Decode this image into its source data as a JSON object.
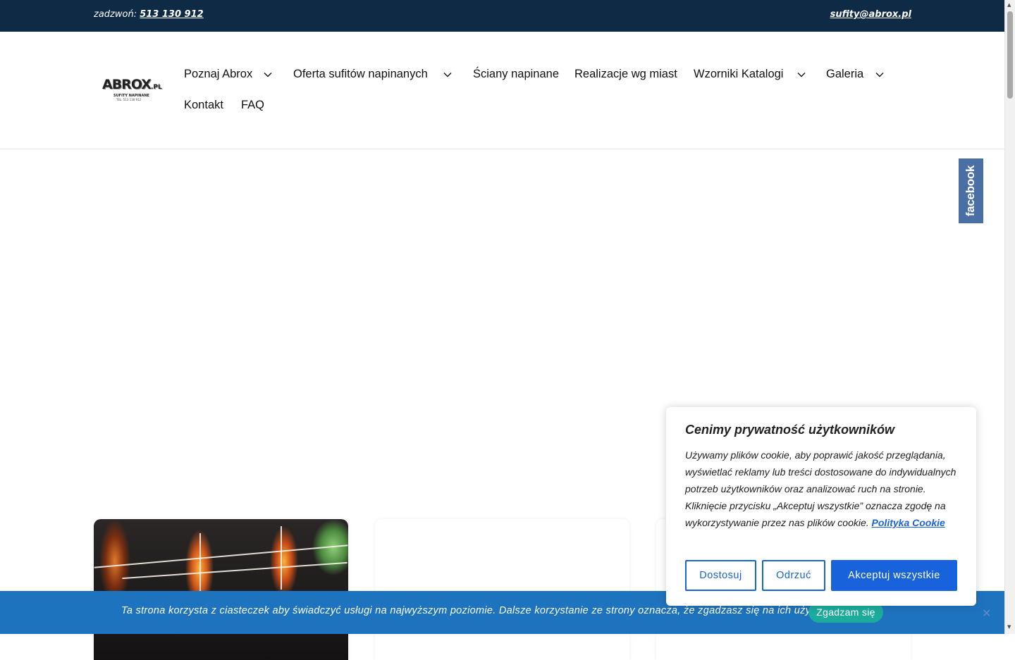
{
  "topbar": {
    "phone_prefix": "zadzwoń:",
    "phone": "513 130 912",
    "email": "sufity@abrox.pl"
  },
  "logo": {
    "brand": "ABROX",
    "domain": ".PL",
    "tagline": "SUFITY NAPINANE",
    "tel": "TEL. 513 130 912"
  },
  "nav": {
    "items": [
      {
        "label": "Poznaj Abrox",
        "has_submenu": true
      },
      {
        "label": "Oferta sufitów napinanych",
        "has_submenu": true
      },
      {
        "label": "Ściany napinane",
        "has_submenu": false
      },
      {
        "label": "Realizacje wg miast",
        "has_submenu": false
      },
      {
        "label": "Wzorniki Katalogi",
        "has_submenu": true
      },
      {
        "label": "Galeria",
        "has_submenu": true
      },
      {
        "label": "Kontakt",
        "has_submenu": false
      },
      {
        "label": "FAQ",
        "has_submenu": false
      }
    ]
  },
  "facebook_tab": {
    "label": "facebook",
    "color": "#4a6fa5"
  },
  "consent": {
    "title": "Cenimy prywatność użytkowników",
    "body": "Używamy plików cookie, aby poprawić jakość przeglądania, wyświetlać reklamy lub treści dostosowane do indywidualnych potrzeb użytkowników oraz analizować ruch na stronie. Kliknięcie przycisku „Akceptuj wszystkie” oznacza zgodę na wykorzystywanie przez nas plików cookie.",
    "policy_link": "Polityka Cookie",
    "customize_label": "Dostosuj",
    "reject_label": "Odrzuć",
    "accept_label": "Akceptuj wszystkie",
    "accent_color": "#1863dc"
  },
  "notice": {
    "text": "Ta strona korzysta z ciasteczek aby świadczyć usługi na najwyższym poziomie. Dalsze korzystanie ze strony oznacza, że zgadzasz się na ich użycie.",
    "agree_label": "Zgadzam się",
    "close_icon": "close-icon",
    "bar_color": "#1e73be",
    "button_color": "#1dab9c"
  },
  "colors": {
    "topbar": "#0f2a44"
  }
}
